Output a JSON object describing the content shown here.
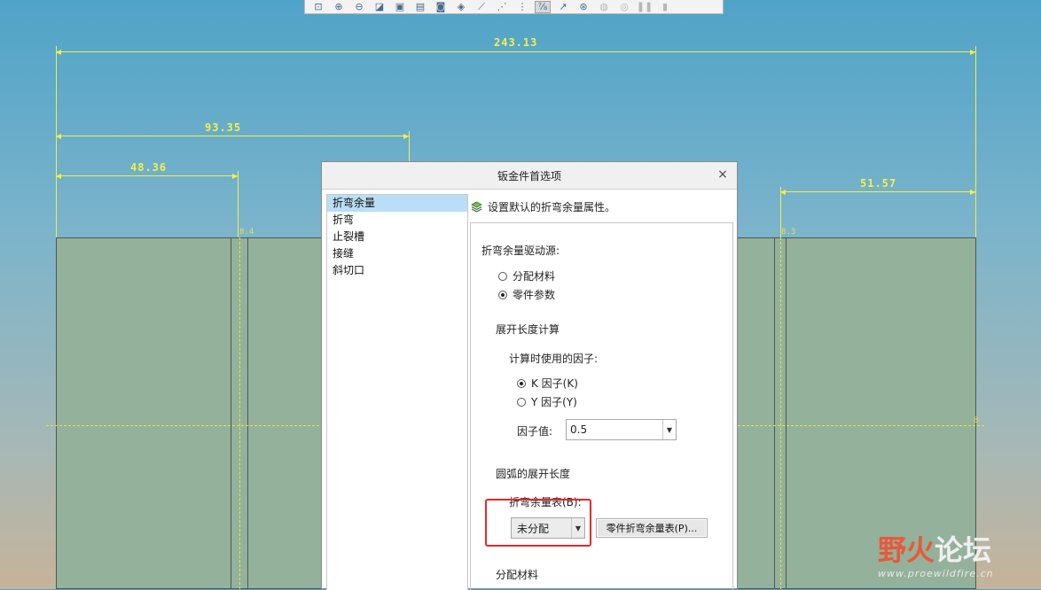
{
  "toolbar": {
    "buttons": [
      "zoom-fit",
      "zoom-in",
      "zoom-out",
      "repaint",
      "view-manager",
      "saved-views",
      "display-style",
      "orient",
      "plane-display",
      "axis-display",
      "point-display",
      "csys-display",
      "annotation-display",
      "spin-center",
      "hidden-1",
      "hidden-2",
      "hidden-3",
      "hidden-4"
    ]
  },
  "drawing": {
    "dim_overall": "243.13",
    "dim_93": "93.35",
    "dim_48": "48.36",
    "dim_51": "51.57",
    "mark_left": "8.4",
    "mark_right": "8.3",
    "mark_center": "8"
  },
  "dialog": {
    "title": "钣金件首选项",
    "close": "×",
    "nav": [
      "折弯余量",
      "折弯",
      "止裂槽",
      "接缝",
      "斜切口"
    ],
    "heading": "设置默认的折弯余量属性。",
    "drive_label": "折弯余量驱动源:",
    "radio_assign": "分配材料",
    "radio_part": "零件参数",
    "unfold_label": "展开长度计算",
    "factor_label": "计算时使用的因子:",
    "radio_k": "K 因子(K)",
    "radio_y": "Y 因子(Y)",
    "factor_value_label": "因子值:",
    "factor_value": "0.5",
    "arc_label": "圆弧的展开长度",
    "table_label": "折弯余量表(B):",
    "table_value": "未分配",
    "part_table_button": "零件折弯余量表(P)...",
    "assign_material_label": "分配材料"
  },
  "watermark": {
    "text_a": "野火",
    "text_b": "论坛",
    "url": "www.proewildfire.cn"
  },
  "colors": {
    "dimension": "#f4f04a",
    "part_fill": "#94b19b",
    "highlight": "#e32a2a",
    "selection": "#b9def5"
  }
}
